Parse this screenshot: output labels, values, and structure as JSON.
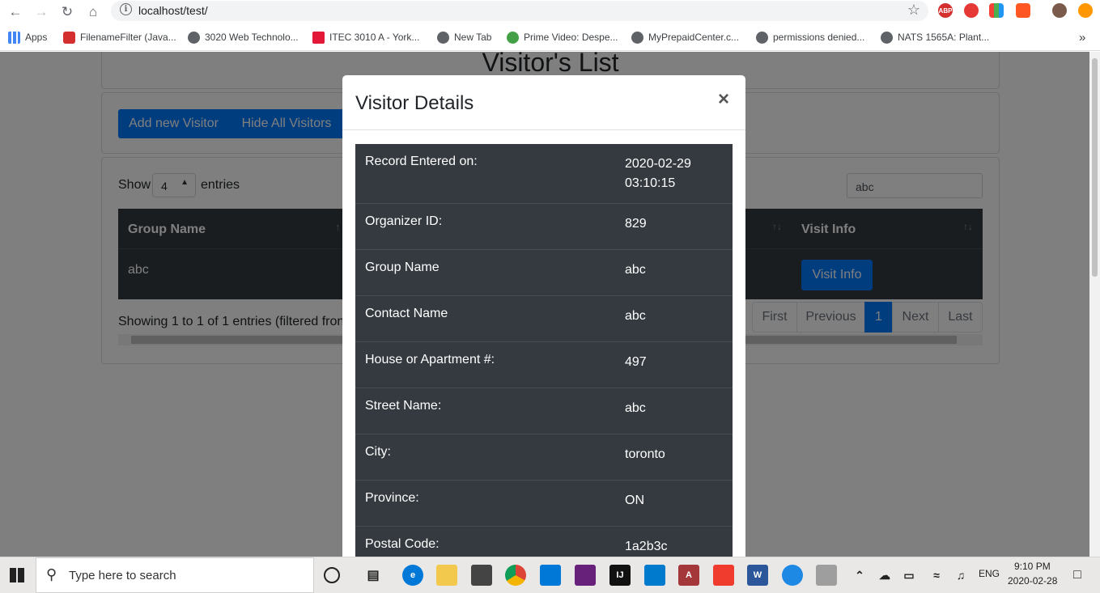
{
  "browser": {
    "url": "localhost/test/",
    "bookmarks": [
      "Apps",
      "FilenameFilter (Java...",
      "3020 Web Technolo...",
      "ITEC 3010 A - York...",
      "New Tab",
      "Prime Video: Despe...",
      "MyPrepaidCenter.c...",
      "permissions denied...",
      "NATS 1565A: Plant..."
    ],
    "extensions": [
      "ABP"
    ],
    "more": "»"
  },
  "page": {
    "title": "Visitor's List",
    "add_button": "Add new Visitor",
    "hide_button": "Hide All Visitors",
    "show_label": "Show",
    "show_value": "4",
    "entries_label": "entries",
    "search_value": "abc",
    "table": {
      "headers": [
        "Group Name",
        "Visit Info"
      ],
      "row": {
        "group_name": "abc",
        "visit_button": "Visit Info"
      }
    },
    "showing_text": "Showing 1 to 1 of 1 entries (filtered fron",
    "pagination": [
      "First",
      "Previous",
      "1",
      "Next",
      "Last"
    ]
  },
  "modal": {
    "title": "Visitor Details",
    "close": "×",
    "rows": [
      {
        "label": "Record Entered on:",
        "value": "2020-02-29 03:10:15"
      },
      {
        "label": "Organizer ID:",
        "value": "829"
      },
      {
        "label": "Group Name",
        "value": "abc"
      },
      {
        "label": "Contact Name",
        "value": "abc"
      },
      {
        "label": "House or Apartment #:",
        "value": "497"
      },
      {
        "label": "Street Name:",
        "value": "abc"
      },
      {
        "label": "City:",
        "value": "toronto"
      },
      {
        "label": "Province:",
        "value": "ON"
      },
      {
        "label": "Postal Code:",
        "value": "1a2b3c"
      }
    ]
  },
  "taskbar": {
    "search_placeholder": "Type here to search",
    "lang": "ENG",
    "time": "9:10 PM",
    "date": "2020-02-28"
  },
  "colors": {
    "primary": "#007bff",
    "table_dark": "#343a40"
  }
}
